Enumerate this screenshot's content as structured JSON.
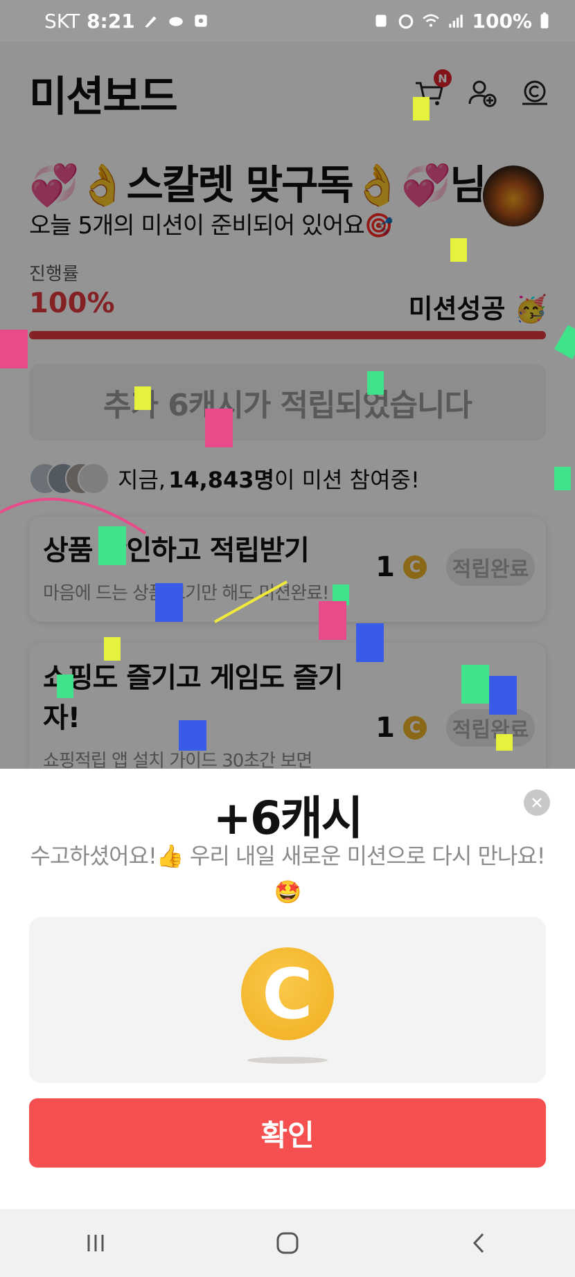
{
  "status_bar": {
    "carrier": "SKT",
    "time": "8:21",
    "battery": "100%"
  },
  "header": {
    "title": "미션보드",
    "cart_badge": "N"
  },
  "greeting": {
    "emoji_left": "💞👌",
    "name": "스칼렛 맞구독",
    "emoji_right": "👌💞",
    "suffix": "님",
    "subtitle": "오늘 5개의 미션이 준비되어 있어요🎯"
  },
  "progress": {
    "label": "진행률",
    "value_text": "100%",
    "value": 1.0,
    "status": "미션성공 🥳"
  },
  "notice": {
    "text": "추가 6캐시가 적립되었습니다"
  },
  "participants": {
    "prefix": "지금,",
    "count": "14,843명",
    "suffix": "이 미션 참여중!"
  },
  "missions": [
    {
      "title": "상품 확인하고 적립받기",
      "desc": "마음에 드는 상품 보기만 해도 미션완료!",
      "reward": "1",
      "button": "적립완료"
    },
    {
      "title": "쇼핑도 즐기고 게임도 즐기자!",
      "desc": "쇼핑적립 앱 설치 가이드 30초간 보면",
      "reward": "1",
      "button": "적립완료"
    }
  ],
  "sheet": {
    "title": "+6캐시",
    "message": "수고하셨어요!👍 우리 내일 새로운 미션으로 다시 만나요!🤩",
    "coin_symbol": "C",
    "confirm": "확인"
  },
  "colors": {
    "accent": "#f5504f",
    "progress": "#e23a3f",
    "coin": "#f0b429"
  },
  "icons": [
    "cart-icon",
    "add-friend-icon",
    "cash-icon",
    "close-icon",
    "recents-icon",
    "home-icon",
    "back-icon"
  ]
}
